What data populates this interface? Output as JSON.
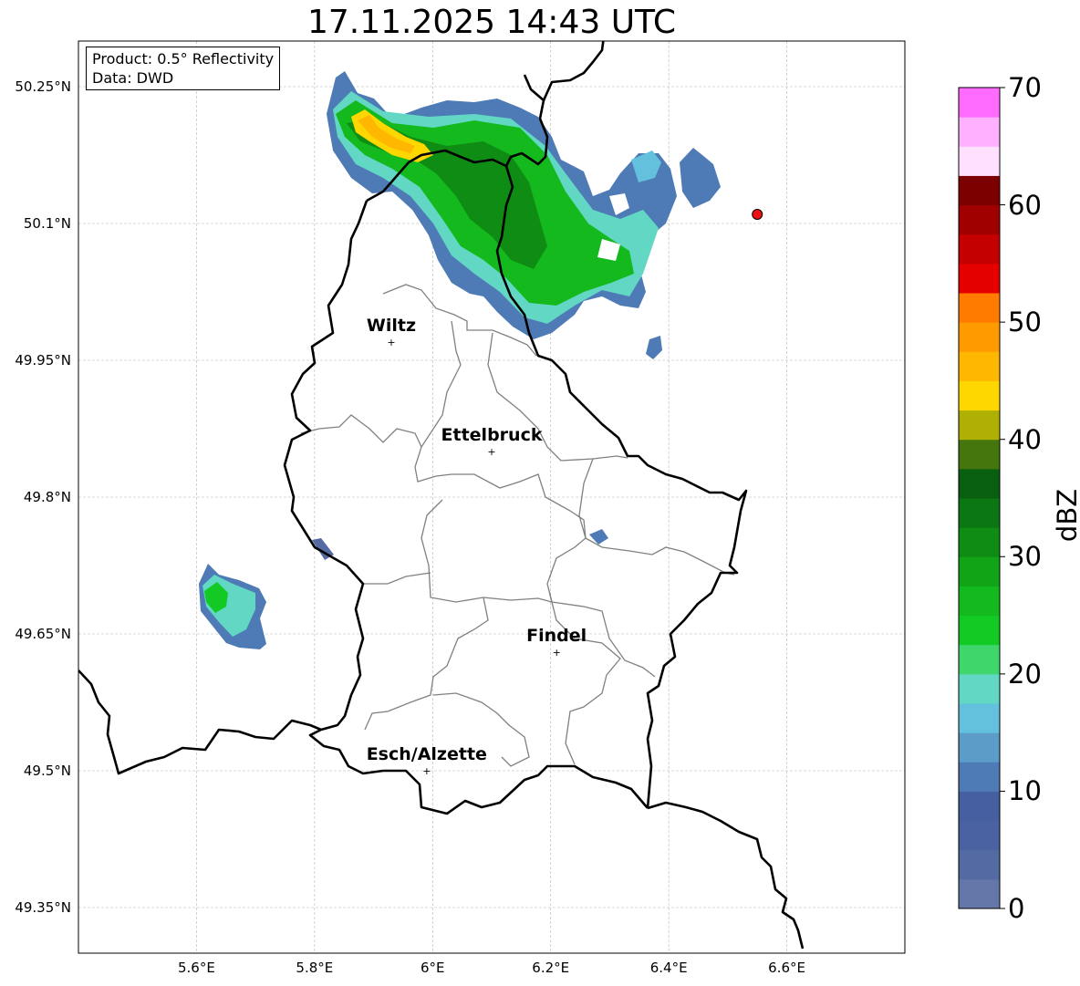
{
  "title": "17.11.2025 14:43 UTC",
  "info_box": {
    "product": "Product: 0.5° Reflectivity",
    "data_source": "Data: DWD"
  },
  "axes": {
    "lat_ticks": [
      "50.25°N",
      "50.1°N",
      "49.95°N",
      "49.8°N",
      "49.65°N",
      "49.5°N",
      "49.35°N"
    ],
    "lon_ticks": [
      "5.6°E",
      "5.8°E",
      "6°E",
      "6.2°E",
      "6.4°E",
      "6.6°E"
    ],
    "lon_range": [
      5.4,
      6.8
    ],
    "lat_range": [
      49.3,
      50.3
    ],
    "grid": true
  },
  "places": [
    {
      "name": "Wiltz",
      "lon": 5.93,
      "lat": 49.97
    },
    {
      "name": "Ettelbruck",
      "lon": 6.1,
      "lat": 49.85
    },
    {
      "name": "Findel",
      "lon": 6.21,
      "lat": 49.63
    },
    {
      "name": "Esch/Alzette",
      "lon": 5.99,
      "lat": 49.5
    }
  ],
  "radar_site": {
    "lon": 6.55,
    "lat": 50.11,
    "color": "#ee1111"
  },
  "colorbar": {
    "label": "dBZ",
    "tick_labels": [
      "0",
      "10",
      "20",
      "30",
      "40",
      "50",
      "60",
      "70"
    ],
    "min": 0,
    "max": 70,
    "step": 2.5,
    "colors": [
      "#6577a8",
      "#546aa2",
      "#4a62a2",
      "#455fa0",
      "#4e7bb5",
      "#5b9cc8",
      "#63c1de",
      "#62d8c4",
      "#3fd66c",
      "#13c923",
      "#13b91d",
      "#10a416",
      "#0e8c14",
      "#0b7712",
      "#095f10",
      "#45760d",
      "#aeb104",
      "#ffd700",
      "#ffb700",
      "#ff9b00",
      "#ff7c00",
      "#e50000",
      "#c40000",
      "#a10000",
      "#7d0000",
      "#ffe0ff",
      "#ffb0ff",
      "#ff6bff",
      "#ee35ee"
    ]
  }
}
